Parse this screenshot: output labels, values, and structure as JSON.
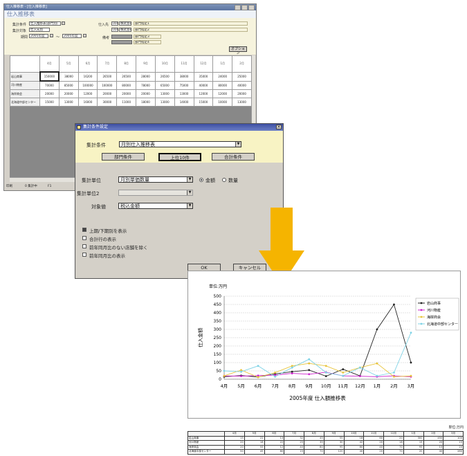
{
  "back_window": {
    "title": "仕入推移表 - [仕入推移表]",
    "heading": "仕入推移表",
    "filters": {
      "agg_condition_label": "集計条件",
      "agg_condition_value": "仕入推移表(部門別)",
      "agg_target_label": "集計対象",
      "agg_target_value": "仕入先別",
      "period_label": "期間",
      "period_from": "2005年度",
      "period_sep": "～",
      "period_to": "2005年度",
      "supplier_label": "仕入先",
      "supplier_code": "0000",
      "supplier_name": "株式会社",
      "range_tag": "部門指定1",
      "range_tag2": "部門指定2",
      "memo_label": "備考",
      "memo_value": "部門指定3",
      "memo_value2": "部門指定4",
      "option_button": "オプション",
      "btn_settings": "集計設定"
    },
    "grid": {
      "months": [
        "4月",
        "5月",
        "6月",
        "7月",
        "8月",
        "9月",
        "10月",
        "11月",
        "12月",
        "1月",
        "2月"
      ],
      "rows": [
        {
          "label": "岩山商事",
          "values": [
            "150000",
            "38000",
            "16200",
            "26500",
            "26500",
            "28000",
            "26500",
            "38000",
            "35000",
            "24000",
            "25000"
          ]
        },
        {
          "label": "河川物産",
          "values": [
            "70000",
            "85000",
            "100000",
            "100000",
            "80000",
            "78000",
            "65000",
            "75000",
            "40000",
            "80000",
            "40000"
          ]
        },
        {
          "label": "海岸商会",
          "values": [
            "20000",
            "20000",
            "12000",
            "20000",
            "20000",
            "20000",
            "13000",
            "13000",
            "12000",
            "12000",
            "20000"
          ]
        },
        {
          "label": "北海道中部センター",
          "values": [
            "15000",
            "13000",
            "16000",
            "30000",
            "11000",
            "18000",
            "13000",
            "14000",
            "15000",
            "10000",
            "13000"
          ]
        }
      ]
    },
    "status": {
      "left": "印刷",
      "mid": "0 集計中",
      "right": "F1"
    }
  },
  "dialog": {
    "title": "集計条件設定",
    "cond_label": "集計条件",
    "cond_value": "月別仕入推移表",
    "tabs": [
      "部門条件",
      "上位10件",
      "合計条件"
    ],
    "unit_label": "集計単位",
    "unit_value": "月別単価数量",
    "unit2_label": "集計単位2",
    "unit2_value": "",
    "target_label": "対象値",
    "target_value": "税込金額",
    "radio_a": "金額",
    "radio_b": "数量",
    "checks": [
      {
        "label": "上期/下期別を表示",
        "checked": true
      },
      {
        "label": "合計行の表示",
        "checked": false
      },
      {
        "label": "前年同月比のない店舗を除く",
        "checked": false
      },
      {
        "label": "前年同月比の表示",
        "checked": false
      }
    ],
    "ok_label": "OK",
    "cancel_label": "キャンセル"
  },
  "arrow_color": "#f5b400",
  "chart_data": {
    "type": "line",
    "title": "2005年度 仕入額推移表",
    "unit_label": "単位:万円",
    "ylabel": "仕入金額",
    "xlabel": "",
    "categories": [
      "4月",
      "5月",
      "6月",
      "7月",
      "8月",
      "9月",
      "10月",
      "11月",
      "12月",
      "1月",
      "2月",
      "3月"
    ],
    "ylim": [
      0,
      500
    ],
    "yticks": [
      0,
      50,
      100,
      150,
      200,
      250,
      300,
      350,
      400,
      450,
      500
    ],
    "grid": true,
    "legend": "right",
    "series": [
      {
        "name": "岩山商事",
        "color": "#222222",
        "values": [
          15,
          22,
          13,
          32,
          45,
          55,
          18,
          60,
          20,
          300,
          450,
          100
        ]
      },
      {
        "name": "河川物産",
        "color": "#cc22cc",
        "values": [
          20,
          18,
          22,
          25,
          35,
          30,
          42,
          20,
          18,
          15,
          20,
          15
        ]
      },
      {
        "name": "海岸商会",
        "color": "#e8c43a",
        "values": [
          20,
          55,
          12,
          40,
          80,
          95,
          80,
          40,
          70,
          95,
          15,
          20
        ]
      },
      {
        "name": "北海道中部センター",
        "color": "#7fd3e6",
        "values": [
          50,
          45,
          80,
          15,
          70,
          120,
          40,
          20,
          70,
          20,
          40,
          280
        ]
      }
    ]
  },
  "bottom_table": {
    "unit": "単位:万円",
    "headers": [
      "",
      "4月",
      "5月",
      "6月",
      "7月",
      "8月",
      "9月",
      "10月",
      "11月",
      "12月",
      "1月",
      "2月",
      "3月"
    ],
    "rows": [
      {
        "label": "岩山商事",
        "values": [
          "15",
          "22",
          "13",
          "32",
          "45",
          "55",
          "18",
          "60",
          "20",
          "300",
          "450",
          "100"
        ]
      },
      {
        "label": "河川物産",
        "values": [
          "20",
          "18",
          "22",
          "25",
          "35",
          "30",
          "42",
          "20",
          "18",
          "15",
          "20",
          "15"
        ]
      },
      {
        "label": "海岸商会",
        "values": [
          "20",
          "55",
          "12",
          "40",
          "80",
          "95",
          "80",
          "40",
          "70",
          "95",
          "15",
          "20"
        ]
      },
      {
        "label": "北海道中部センター",
        "values": [
          "50",
          "45",
          "80",
          "15",
          "70",
          "120",
          "40",
          "20",
          "70",
          "20",
          "40",
          "280"
        ]
      }
    ]
  }
}
